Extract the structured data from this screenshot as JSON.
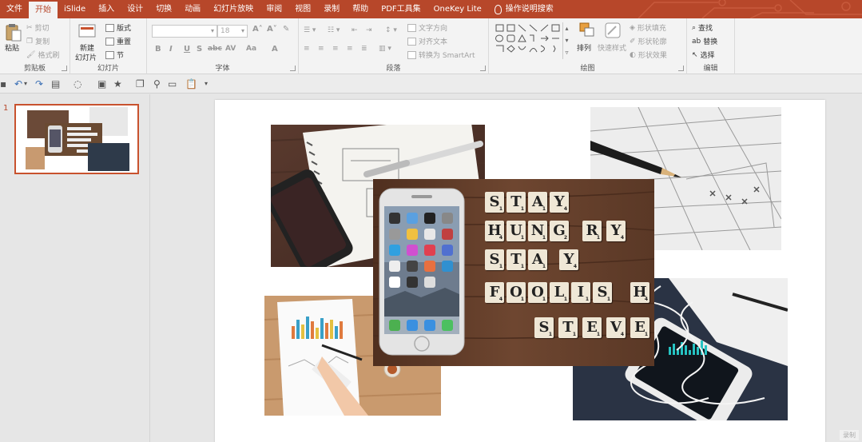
{
  "tabs": [
    "文件",
    "开始",
    "iSlide",
    "插入",
    "设计",
    "切换",
    "动画",
    "幻灯片放映",
    "审阅",
    "视图",
    "录制",
    "帮助",
    "PDF工具集",
    "OneKey Lite"
  ],
  "active_tab": "开始",
  "search_tab": "操作说明搜索",
  "ribbon": {
    "clipboard": {
      "label": "剪贴板",
      "paste": "粘贴",
      "cut": "剪切",
      "copy": "复制",
      "painter": "格式刷"
    },
    "slides": {
      "label": "幻灯片",
      "new_slide_1": "新建",
      "new_slide_2": "幻灯片",
      "layout": "版式",
      "reset": "重置",
      "section": "节"
    },
    "font": {
      "label": "字体",
      "font_name": "",
      "font_size": "18",
      "bold": "B",
      "italic": "I",
      "underline": "U",
      "strike": "S",
      "shadow": "abc",
      "spacing": "AV",
      "case": "Aa",
      "color": "A"
    },
    "paragraph": {
      "label": "段落",
      "text_direction": "文字方向",
      "align_text": "对齐文本",
      "smartart": "转换为 SmartArt"
    },
    "drawing": {
      "label": "绘图",
      "arrange": "排列",
      "quick_styles": "快速样式",
      "shape_fill": "形状填充",
      "shape_outline": "形状轮廓",
      "shape_effects": "形状效果"
    },
    "editing": {
      "label": "编辑",
      "find": "查找",
      "replace": "替换",
      "select": "选择"
    }
  },
  "thumbnail": {
    "number": "1"
  },
  "slide": {
    "tiles_row1": [
      "S",
      "T",
      "A",
      "Y"
    ],
    "tiles_row2": [
      "H",
      "U",
      "N",
      "G",
      "R",
      "Y"
    ],
    "tiles_row3": [
      "S",
      "T",
      "A",
      "Y"
    ],
    "tiles_row4": [
      "F",
      "O",
      "O",
      "L",
      "I",
      "S",
      "H"
    ],
    "tiles_row5": [
      "S",
      "T",
      "E",
      "V",
      "E"
    ],
    "scores_row1": [
      "1",
      "1",
      "1",
      "4"
    ],
    "scores_row2": [
      "4",
      "1",
      "1",
      "2",
      "1",
      "4"
    ],
    "scores_row3": [
      "1",
      "1",
      "1",
      "4"
    ],
    "scores_row4": [
      "4",
      "1",
      "1",
      "1",
      "1",
      "1",
      "4"
    ],
    "scores_row5": [
      "1",
      "1",
      "1",
      "4",
      "1"
    ]
  },
  "status": {
    "right_badge": "录制"
  },
  "colors": {
    "accent": "#b7472a",
    "ribbon_bg": "#f3f3f3",
    "workspace_bg": "#e6e6e6"
  }
}
